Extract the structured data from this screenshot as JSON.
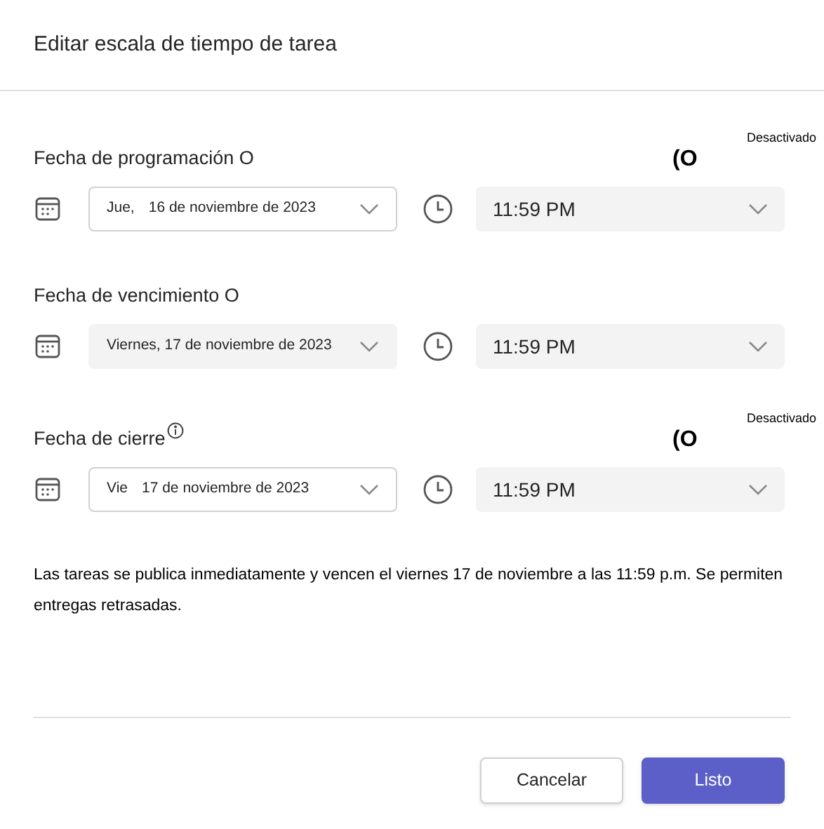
{
  "dialog": {
    "title": "Editar escala de tiempo de tarea"
  },
  "sections": [
    {
      "label": "Fecha de programación O",
      "info": false,
      "toggle": {
        "mark": "(O",
        "state_label": "Desactivado"
      },
      "date": {
        "kind": "outlined",
        "prefix": "Jue,",
        "value": "16 de noviembre de 2023"
      },
      "time": {
        "value": "11:59 PM"
      }
    },
    {
      "label": "Fecha de vencimiento O",
      "info": false,
      "date": {
        "kind": "filled",
        "value": "Viernes, 17 de noviembre de 2023"
      },
      "time": {
        "value": "11:59 PM"
      }
    },
    {
      "label": "Fecha de cierre",
      "info": true,
      "toggle": {
        "mark": "(O",
        "state_label": "Desactivado"
      },
      "date": {
        "kind": "outlined",
        "prefix": "Vie",
        "value": "17 de noviembre de 2023"
      },
      "time": {
        "value": "11:59 PM"
      }
    }
  ],
  "summary": "Las tareas se publica inmediatamente y vencen el viernes 17 de noviembre a las 11:59 p.m. Se permiten entregas retrasadas.",
  "buttons": [
    {
      "label": "Cancelar",
      "kind": "secondary"
    },
    {
      "label": "Listo",
      "kind": "primary"
    }
  ]
}
